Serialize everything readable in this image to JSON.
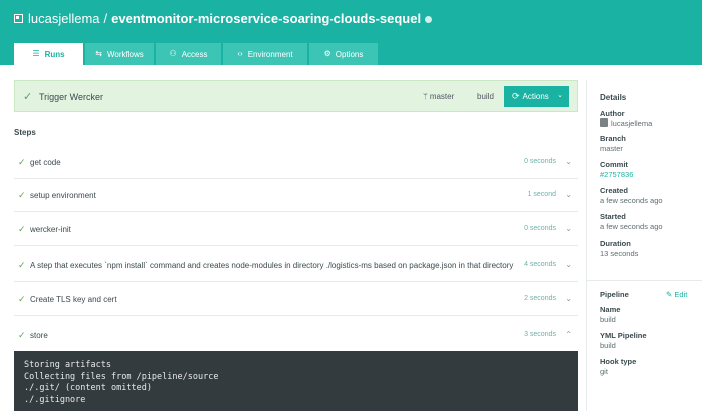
{
  "header": {
    "owner": "lucasjellema",
    "separator": "/",
    "repo": "eventmonitor-microservice-soaring-clouds-sequel",
    "bg_color": "#1ab2a2"
  },
  "tabs": [
    {
      "label": "Runs",
      "icon": "runs-icon",
      "active": true
    },
    {
      "label": "Workflows",
      "icon": "workflows-icon",
      "active": false
    },
    {
      "label": "Access",
      "icon": "access-icon",
      "active": false
    },
    {
      "label": "Environment",
      "icon": "environment-icon",
      "active": false
    },
    {
      "label": "Options",
      "icon": "options-icon",
      "active": false
    }
  ],
  "trigger": {
    "label": "Trigger Wercker",
    "branch": "master",
    "pipeline": "build",
    "actions_label": "Actions",
    "status_color": "#5ba457"
  },
  "steps_heading": "Steps",
  "steps": [
    {
      "name": "get code",
      "duration": "0 seconds",
      "expanded": false
    },
    {
      "name": "setup environment",
      "duration": "1 second",
      "expanded": false
    },
    {
      "name": "wercker-init",
      "duration": "0 seconds",
      "expanded": false
    },
    {
      "name": "A step that executes `npm install` command and creates node-modules in directory ./logistics-ms based on package.json in that directory",
      "duration": "4 seconds",
      "expanded": false
    },
    {
      "name": "Create TLS key and cert",
      "duration": "2 seconds",
      "expanded": false
    },
    {
      "name": "store",
      "duration": "3 seconds",
      "expanded": true
    }
  ],
  "terminal": {
    "lines": [
      "Storing artifacts",
      "Collecting files from /pipeline/source",
      "./.git/ (content omitted)",
      "./.gitignore"
    ]
  },
  "details": {
    "title": "Details",
    "author_label": "Author",
    "author_value": "lucasjellema",
    "branch_label": "Branch",
    "branch_value": "master",
    "commit_label": "Commit",
    "commit_value": "#2757836",
    "created_label": "Created",
    "created_value": "a few seconds ago",
    "started_label": "Started",
    "started_value": "a few seconds ago",
    "duration_label": "Duration",
    "duration_value": "13 seconds",
    "pipeline_label": "Pipeline",
    "edit_label": "Edit",
    "name_label": "Name",
    "name_value": "build",
    "yml_label": "YML Pipeline",
    "yml_value": "build",
    "hook_label": "Hook type",
    "hook_value": "git"
  }
}
